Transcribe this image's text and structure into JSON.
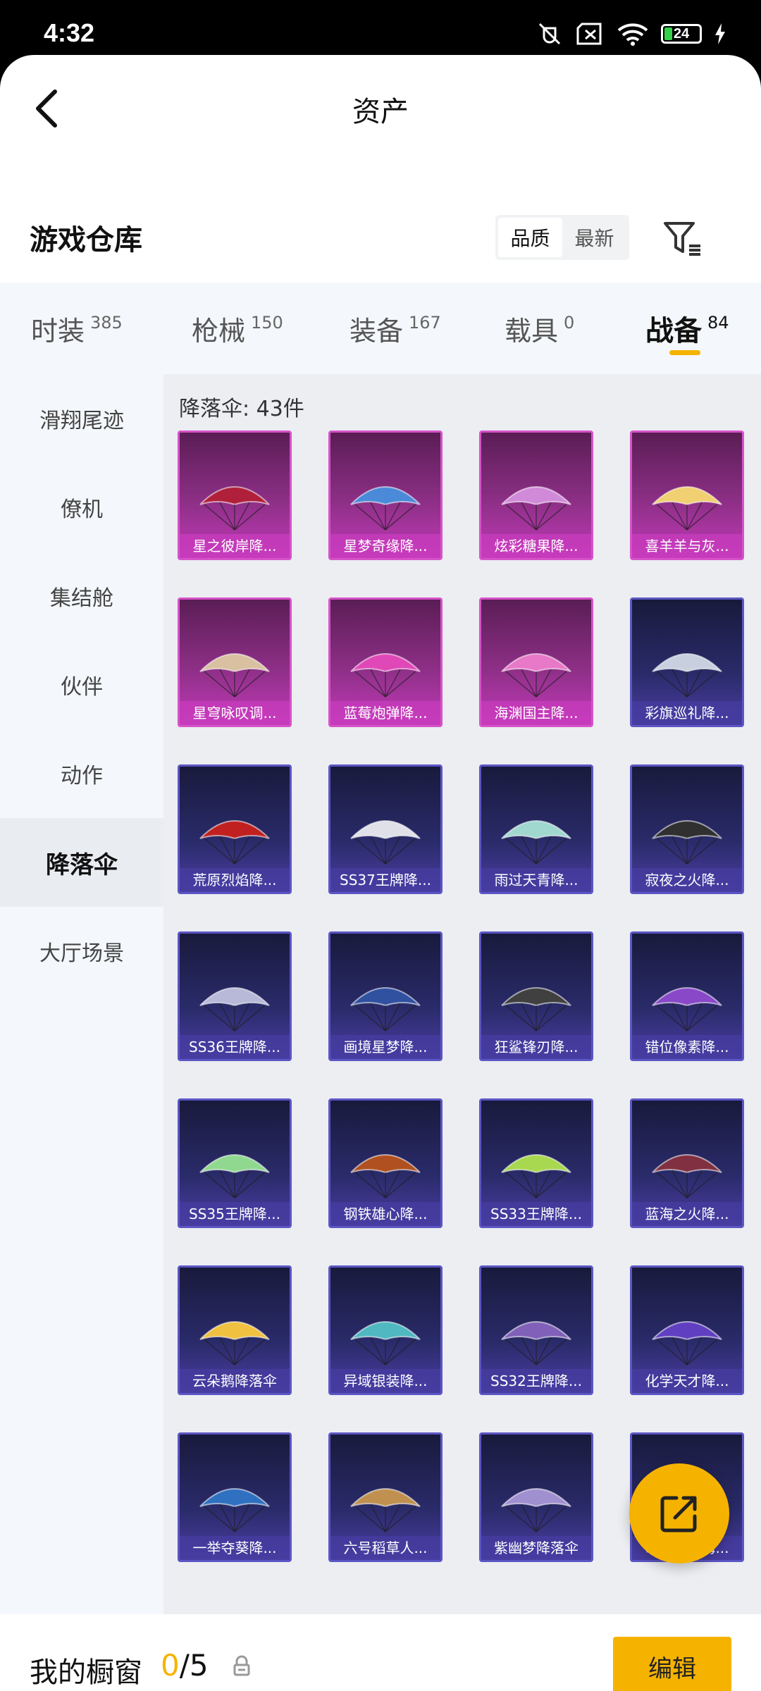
{
  "status_bar": {
    "time": "4:32",
    "battery": "24"
  },
  "header": {
    "title": "资产"
  },
  "warehouse": {
    "title": "游戏仓库",
    "sort_options": [
      "品质",
      "最新"
    ],
    "active_sort": "品质"
  },
  "tabs": [
    {
      "label": "时装",
      "count": "385"
    },
    {
      "label": "枪械",
      "count": "150"
    },
    {
      "label": "装备",
      "count": "167"
    },
    {
      "label": "载具",
      "count": "0"
    },
    {
      "label": "战备",
      "count": "84"
    }
  ],
  "active_tab": "战备",
  "sidebar": {
    "items": [
      "滑翔尾迹",
      "僚机",
      "集结舱",
      "伙伴",
      "动作",
      "降落伞",
      "大厅场景"
    ],
    "active": "降落伞"
  },
  "content": {
    "count_label": "降落伞: 43件",
    "items": [
      {
        "name": "星之彼岸降...",
        "rarity": "purple",
        "color": "#b0203a"
      },
      {
        "name": "星梦奇缘降...",
        "rarity": "purple",
        "color": "#4a8ad8"
      },
      {
        "name": "炫彩糖果降...",
        "rarity": "purple",
        "color": "#d08ad8"
      },
      {
        "name": "喜羊羊与灰...",
        "rarity": "purple",
        "color": "#f0d070"
      },
      {
        "name": "星穹咏叹调...",
        "rarity": "purple",
        "color": "#d8c0a0"
      },
      {
        "name": "蓝莓炮弹降...",
        "rarity": "purple",
        "color": "#e048b8"
      },
      {
        "name": "海渊国主降...",
        "rarity": "purple",
        "color": "#e878c8"
      },
      {
        "name": "彩旗巡礼降...",
        "rarity": "blue",
        "color": "#c8d0e0"
      },
      {
        "name": "荒原烈焰降...",
        "rarity": "blue",
        "color": "#c02020"
      },
      {
        "name": "SS37王牌降...",
        "rarity": "blue",
        "color": "#e0e0e8"
      },
      {
        "name": "雨过天青降...",
        "rarity": "blue",
        "color": "#a0d8d0"
      },
      {
        "name": "寂夜之火降...",
        "rarity": "blue",
        "color": "#303030"
      },
      {
        "name": "SS36王牌降...",
        "rarity": "blue",
        "color": "#b8b8d8"
      },
      {
        "name": "画境星梦降...",
        "rarity": "blue",
        "color": "#3050a0"
      },
      {
        "name": "狂鲨锋刃降...",
        "rarity": "blue",
        "color": "#404040"
      },
      {
        "name": "错位像素降...",
        "rarity": "blue",
        "color": "#8848c8"
      },
      {
        "name": "SS35王牌降...",
        "rarity": "blue",
        "color": "#90d890"
      },
      {
        "name": "钢铁雄心降...",
        "rarity": "blue",
        "color": "#b05020"
      },
      {
        "name": "SS33王牌降...",
        "rarity": "blue",
        "color": "#a8d850"
      },
      {
        "name": "蓝海之火降...",
        "rarity": "blue",
        "color": "#803040"
      },
      {
        "name": "云朵鹅降落伞",
        "rarity": "blue",
        "color": "#f0c040"
      },
      {
        "name": "异域银装降...",
        "rarity": "blue",
        "color": "#50b8c0"
      },
      {
        "name": "SS32王牌降...",
        "rarity": "blue",
        "color": "#8060b8"
      },
      {
        "name": "化学天才降...",
        "rarity": "blue",
        "color": "#6040c0"
      },
      {
        "name": "一举夺葵降...",
        "rarity": "blue",
        "color": "#3070c0"
      },
      {
        "name": "六号稻草人...",
        "rarity": "blue",
        "color": "#c09050"
      },
      {
        "name": "紫幽梦降落伞",
        "rarity": "blue",
        "color": "#a090d0"
      },
      {
        "name": "萌萌史莱姆...",
        "rarity": "blue",
        "color": "#6050a0"
      }
    ]
  },
  "bottom_bar": {
    "label": "我的橱窗",
    "current": "0",
    "separator": "/",
    "max": "5",
    "edit_label": "编辑"
  },
  "colors": {
    "accent": "#f5b300"
  }
}
